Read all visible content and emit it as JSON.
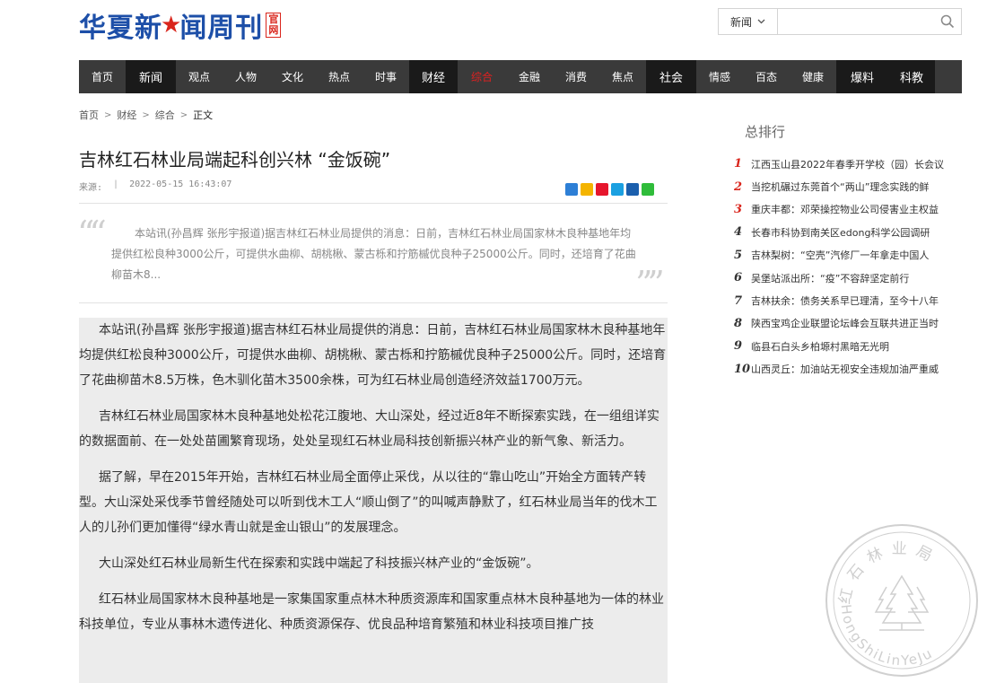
{
  "header": {
    "logo": {
      "part1": "华夏新",
      "part2": "闻周刊",
      "badge_top": "官",
      "badge_bottom": "网"
    },
    "search": {
      "category": "新闻",
      "placeholder": "",
      "icon": "search-icon"
    }
  },
  "nav": [
    {
      "label": "首页",
      "style": "normal"
    },
    {
      "label": "新闻",
      "style": "dark"
    },
    {
      "label": "观点",
      "style": "normal"
    },
    {
      "label": "人物",
      "style": "normal"
    },
    {
      "label": "文化",
      "style": "normal"
    },
    {
      "label": "热点",
      "style": "normal"
    },
    {
      "label": "时事",
      "style": "normal"
    },
    {
      "label": "财经",
      "style": "dark"
    },
    {
      "label": "综合",
      "style": "red"
    },
    {
      "label": "金融",
      "style": "normal"
    },
    {
      "label": "消费",
      "style": "normal"
    },
    {
      "label": "焦点",
      "style": "normal"
    },
    {
      "label": "社会",
      "style": "dark"
    },
    {
      "label": "情感",
      "style": "normal"
    },
    {
      "label": "百态",
      "style": "normal"
    },
    {
      "label": "健康",
      "style": "normal"
    },
    {
      "label": "爆料",
      "style": "dark"
    },
    {
      "label": "科教",
      "style": "dark"
    }
  ],
  "breadcrumb": [
    "首页",
    "财经",
    "综合",
    "正文"
  ],
  "article": {
    "title": "吉林红石林业局端起科创兴林 “金饭碗”",
    "source_label": "来源:",
    "separator": "|",
    "datetime": "2022-05-15 16:43:07",
    "summary": "本站讯(孙昌辉 张彤宇报道)据吉林红石林业局提供的消息：日前，吉林红石林业局国家林木良种基地年均提供红松良种3000公斤，可提供水曲柳、胡桃楸、蒙古栎和拧筋槭优良种子25000公斤。同时，还培育了花曲柳苗木8...",
    "paragraphs": [
      "本站讯(孙昌辉 张彤宇报道)据吉林红石林业局提供的消息：日前，吉林红石林业局国家林木良种基地年均提供红松良种3000公斤，可提供水曲柳、胡桃楸、蒙古栎和拧筋槭优良种子25000公斤。同时，还培育了花曲柳苗木8.5万株，色木驯化苗木3500余株，可为红石林业局创造经济效益1700万元。",
      "吉林红石林业局国家林木良种基地处松花江腹地、大山深处，经过近8年不断探索实践，在一组组详实的数据面前、在一处处苗圃繁育现场，处处呈现红石林业局科技创新振兴林产业的新气象、新活力。",
      "据了解，早在2015年开始，吉林红石林业局全面停止采伐，从以往的“靠山吃山”开始全方面转产转型。大山深处采伐季节曾经随处可以听到伐木工人“顺山倒了”的叫喊声静默了，红石林业局当年的伐木工人的儿孙们更加懂得“绿水青山就是金山银山”的发展理念。",
      "大山深处红石林业局新生代在探索和实践中端起了科技振兴林产业的“金饭碗”。",
      "红石林业局国家林木良种基地是一家集国家重点林木种质资源库和国家重点林木良种基地为一体的林业科技单位，专业从事林木遗传进化、种质资源保存、优良品种培育繁殖和林业科技项目推广技"
    ]
  },
  "sidebar": {
    "title": "总排行",
    "items": [
      {
        "num": "1",
        "text": "江西玉山县2022年春季开学校（园）长会议"
      },
      {
        "num": "2",
        "text": "当挖机碾过东莞首个“两山”理念实践的鲜"
      },
      {
        "num": "3",
        "text": "重庆丰都：邓荣操控物业公司侵害业主权益"
      },
      {
        "num": "4",
        "text": "长春市科协到南关区edong科学公园调研"
      },
      {
        "num": "5",
        "text": "吉林梨树：“空壳”汽修厂一年拿走中国人"
      },
      {
        "num": "6",
        "text": "吴堡站派出所：“疫”不容辞坚定前行"
      },
      {
        "num": "7",
        "text": "吉林扶余：债务关系早已理清，至今十八年"
      },
      {
        "num": "8",
        "text": "陕西宝鸡企业联盟论坛峰会互联共进正当时"
      },
      {
        "num": "9",
        "text": "临县石白头乡柏塬村黑暗无光明"
      },
      {
        "num": "10",
        "text": "山西灵丘：加油站无视安全违规加油严重威"
      }
    ]
  },
  "seal": {
    "chinese": "红石林业局",
    "pinyin": "HongShiLinYeJu"
  },
  "colors": {
    "brand_blue": "#1d4fa8",
    "brand_red": "#d9251c",
    "nav_bg": "#3a3a3a",
    "nav_dark": "#1a1a1a"
  }
}
